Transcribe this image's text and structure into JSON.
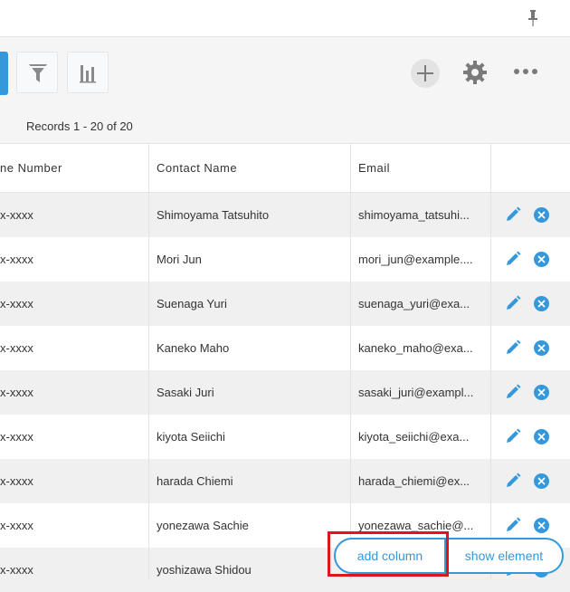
{
  "records_label": "Records 1 - 20 of 20",
  "columns": {
    "phone": "ne Number",
    "contact": "Contact Name",
    "email": "Email"
  },
  "rows": [
    {
      "phone": "x-xxxx",
      "contact": "Shimoyama Tatsuhito",
      "email": "shimoyama_tatsuhi..."
    },
    {
      "phone": "x-xxxx",
      "contact": "Mori Jun",
      "email": "mori_jun@example...."
    },
    {
      "phone": "x-xxxx",
      "contact": "Suenaga Yuri",
      "email": "suenaga_yuri@exa..."
    },
    {
      "phone": "x-xxxx",
      "contact": "Kaneko Maho",
      "email": "kaneko_maho@exa..."
    },
    {
      "phone": "x-xxxx",
      "contact": "Sasaki Juri",
      "email": "sasaki_juri@exampl..."
    },
    {
      "phone": "x-xxxx",
      "contact": "kiyota Seiichi",
      "email": "kiyota_seiichi@exa..."
    },
    {
      "phone": "x-xxxx",
      "contact": "harada Chiemi",
      "email": "harada_chiemi@ex..."
    },
    {
      "phone": "x-xxxx",
      "contact": "yonezawa Sachie",
      "email": "yonezawa_sachie@..."
    },
    {
      "phone": "x-xxxx",
      "contact": "yoshizawa Shidou",
      "email": ""
    }
  ],
  "actions": {
    "add_column": "add column",
    "show_element": "show element"
  },
  "colors": {
    "accent": "#3498db",
    "highlight": "#e0141e"
  },
  "icons": [
    "pin-icon",
    "filter-icon",
    "graph-icon",
    "plus-icon",
    "gear-icon",
    "more-icon",
    "pencil-icon",
    "close-icon"
  ]
}
